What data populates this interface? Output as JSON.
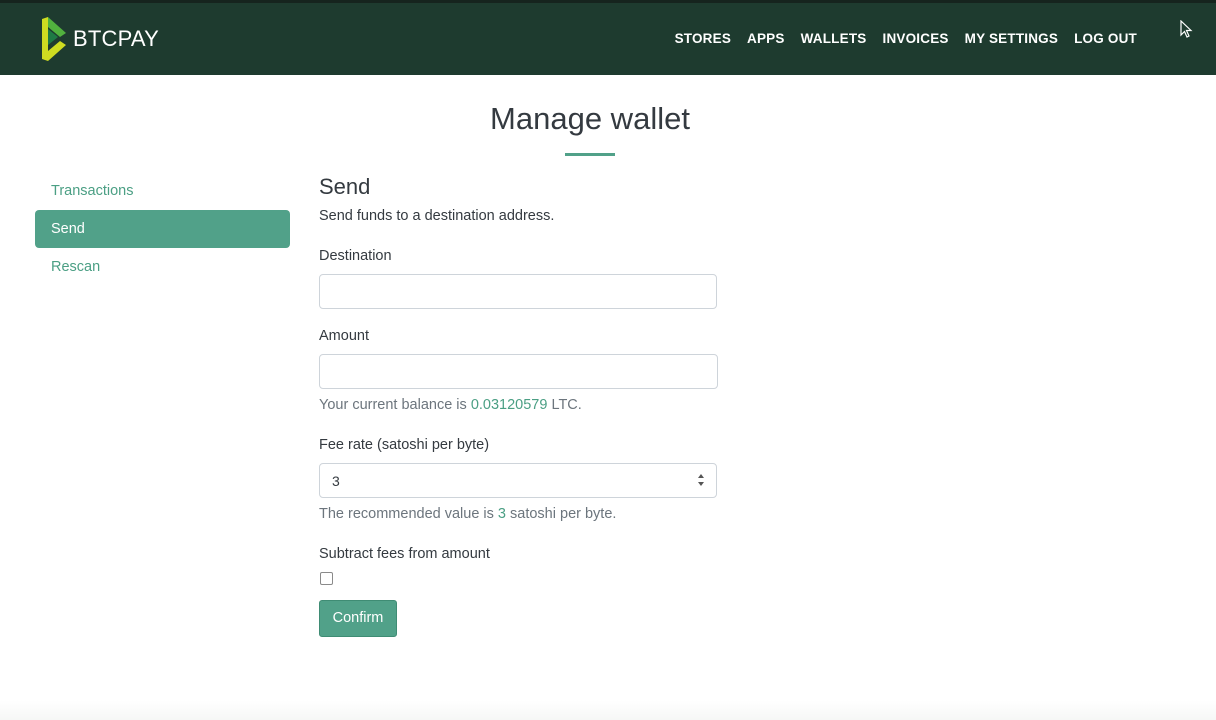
{
  "brand": {
    "name": "BTCPAY"
  },
  "nav": {
    "items": [
      {
        "label": "STORES"
      },
      {
        "label": "APPS"
      },
      {
        "label": "WALLETS"
      },
      {
        "label": "INVOICES"
      },
      {
        "label": "MY SETTINGS"
      },
      {
        "label": "LOG OUT"
      }
    ]
  },
  "page": {
    "title": "Manage wallet"
  },
  "sidebar": {
    "items": [
      {
        "label": "Transactions",
        "active": false
      },
      {
        "label": "Send",
        "active": true
      },
      {
        "label": "Rescan",
        "active": false
      }
    ]
  },
  "send": {
    "title": "Send",
    "description": "Send funds to a destination address.",
    "destination": {
      "label": "Destination",
      "value": "",
      "placeholder": ""
    },
    "amount": {
      "label": "Amount",
      "value": "",
      "placeholder": ""
    },
    "balance": {
      "prefix": "Your current balance is ",
      "value": "0.03120579",
      "suffix": " LTC."
    },
    "fee_rate": {
      "label": "Fee rate (satoshi per byte)",
      "value": "3"
    },
    "recommended": {
      "prefix": "The recommended value is ",
      "value": "3",
      "suffix": " satoshi per byte."
    },
    "subtract_fees": {
      "label": "Subtract fees from amount",
      "checked": false
    },
    "confirm_label": "Confirm"
  },
  "colors": {
    "navbar": "#1e3b2f",
    "accent": "#51a189",
    "link": "#4b9f84",
    "logo_green": "#cedc21",
    "logo_dark_green": "#51b13e"
  },
  "icons": {
    "cursor": "mouse-pointer-icon",
    "logo": "btcpay-logo-icon",
    "spinner": "number-spinner-icon"
  }
}
